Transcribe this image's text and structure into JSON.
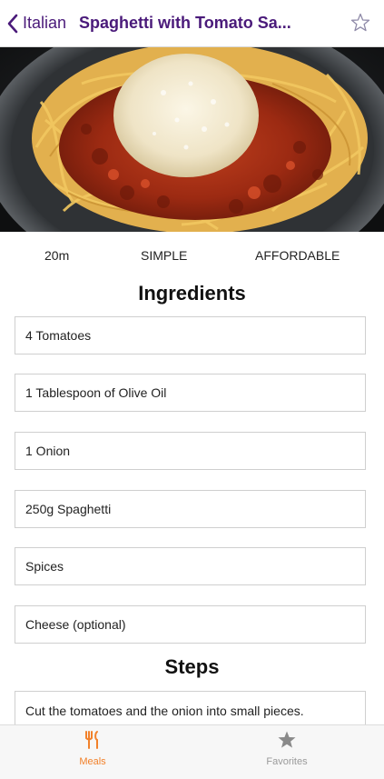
{
  "header": {
    "back_label": "Italian",
    "title": "Spaghetti with Tomato Sa...",
    "back_icon": "chevron-left-icon",
    "favorite_icon": "star-outline-icon",
    "accent_color": "#4a1a7a"
  },
  "hero": {
    "alt": "Spaghetti with tomato sauce and grated cheese"
  },
  "details": {
    "duration": "20m",
    "complexity": "SIMPLE",
    "affordability": "AFFORDABLE"
  },
  "ingredients_title": "Ingredients",
  "ingredients": [
    "4 Tomatoes",
    "1 Tablespoon of Olive Oil",
    "1 Onion",
    "250g Spaghetti",
    "Spices",
    "Cheese (optional)"
  ],
  "steps_title": "Steps",
  "steps": [
    "Cut the tomatoes and the onion into small pieces."
  ],
  "tabbar": {
    "meals_label": "Meals",
    "favorites_label": "Favorites",
    "meals_icon": "cutlery-icon",
    "favorites_icon": "star-filled-icon",
    "active_color": "#f2812a",
    "inactive_color": "#9a9a9a"
  }
}
